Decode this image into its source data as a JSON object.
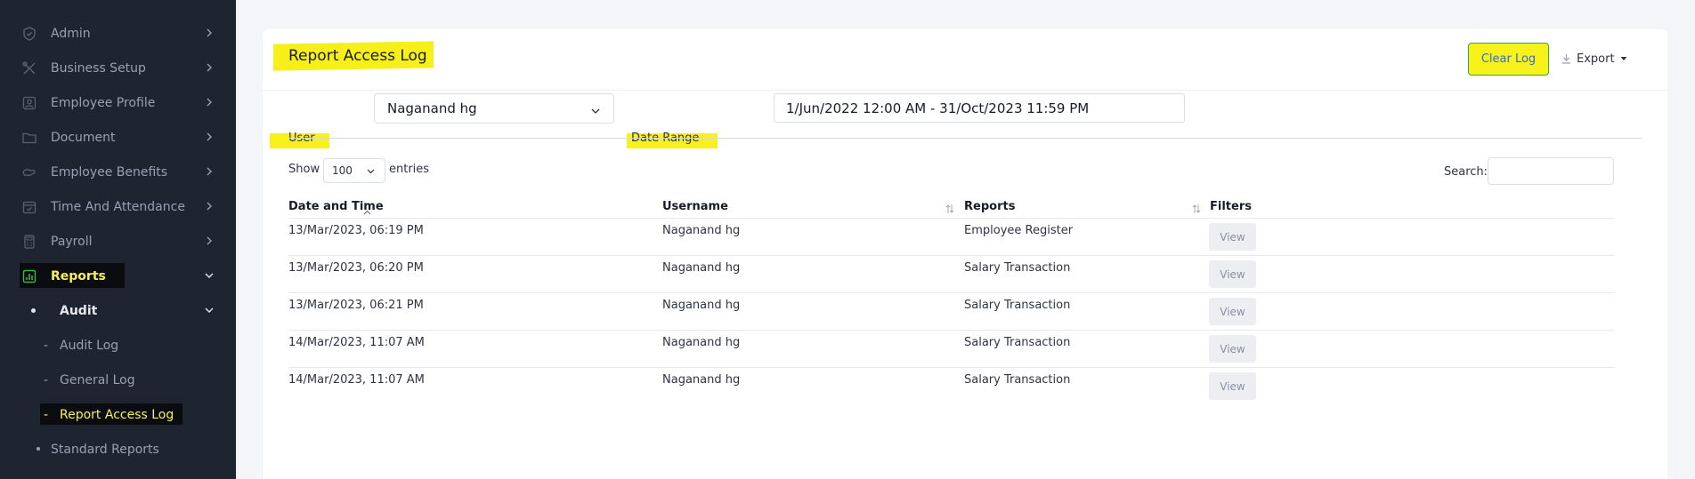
{
  "sidebar": {
    "items": [
      {
        "label": "Admin",
        "icon": "shield-icon"
      },
      {
        "label": "Business Setup",
        "icon": "tools-icon"
      },
      {
        "label": "Employee Profile",
        "icon": "profile-icon"
      },
      {
        "label": "Document",
        "icon": "folder-icon"
      },
      {
        "label": "Employee Benefits",
        "icon": "benefits-icon"
      },
      {
        "label": "Time And Attendance",
        "icon": "calendar-icon"
      },
      {
        "label": "Payroll",
        "icon": "calculator-icon"
      },
      {
        "label": "Reports",
        "icon": "chart-icon"
      }
    ],
    "audit": {
      "label": "Audit"
    },
    "audit_items": [
      "Audit Log",
      "General Log",
      "Report Access Log"
    ],
    "standard_reports": "Standard Reports"
  },
  "card": {
    "title": "Report Access Log",
    "clear_log": "Clear Log",
    "export": "Export"
  },
  "filters": {
    "user_label": "User",
    "user_value": "Naganand hg",
    "date_label": "Date Range",
    "date_value": "1/Jun/2022 12:00 AM - 31/Oct/2023 11:59 PM"
  },
  "table_controls": {
    "show": "Show",
    "entries_value": "100",
    "entries": "entries",
    "search": "Search:"
  },
  "table": {
    "headers": [
      "Date and Time",
      "Username",
      "Reports",
      "Filters"
    ],
    "rows": [
      {
        "date": "13/Mar/2023, 06:19 PM",
        "user": "Naganand hg",
        "report": "Employee Register",
        "action": "View"
      },
      {
        "date": "13/Mar/2023, 06:20 PM",
        "user": "Naganand hg",
        "report": "Salary Transaction",
        "action": "View"
      },
      {
        "date": "13/Mar/2023, 06:21 PM",
        "user": "Naganand hg",
        "report": "Salary Transaction",
        "action": "View"
      },
      {
        "date": "14/Mar/2023, 11:07 AM",
        "user": "Naganand hg",
        "report": "Salary Transaction",
        "action": "View"
      },
      {
        "date": "14/Mar/2023, 11:07 AM",
        "user": "Naganand hg",
        "report": "Salary Transaction",
        "action": "View"
      }
    ]
  },
  "colors": {
    "sidebar_bg": "#1f2431",
    "highlight_yellow": "#f7f31a",
    "active_text": "#f6f15b",
    "active_icon": "#3bb54a"
  }
}
